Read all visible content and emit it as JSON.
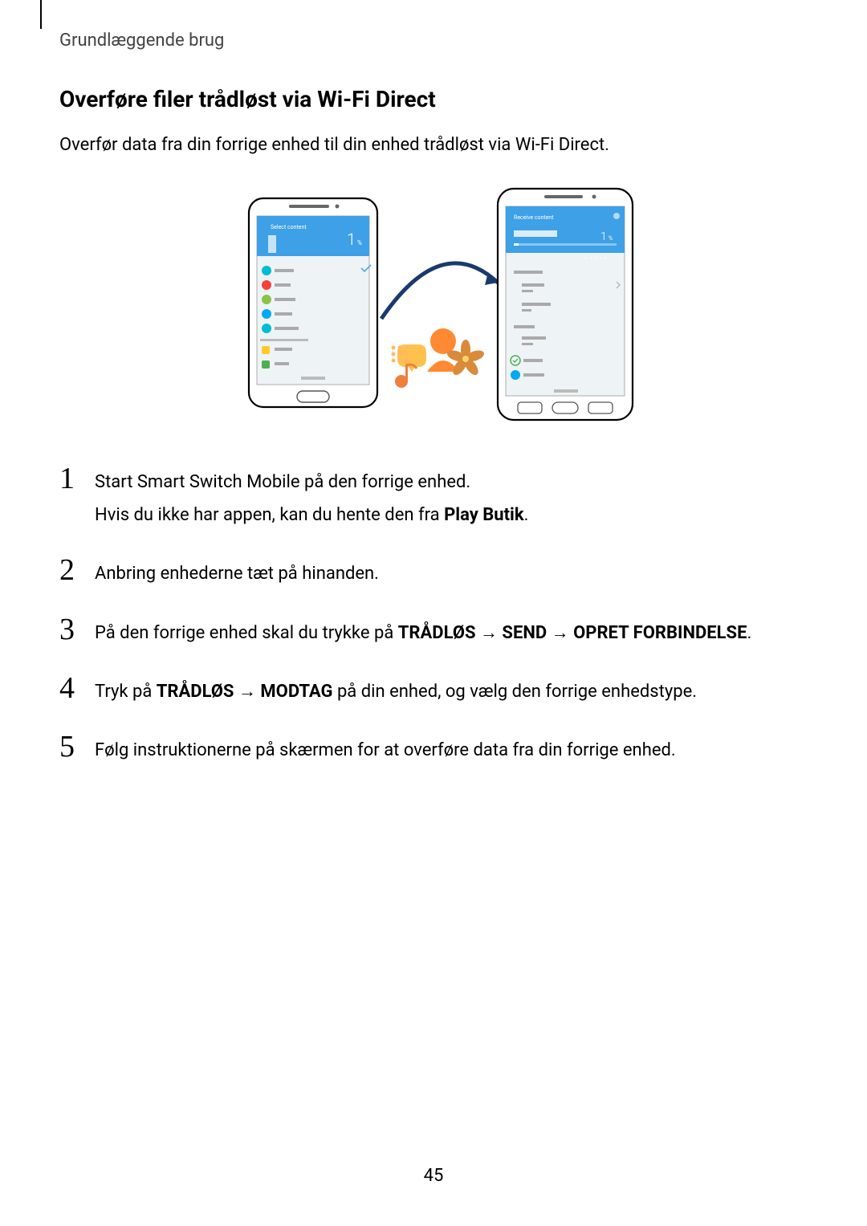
{
  "breadcrumb": "Grundlæggende brug",
  "heading": "Overføre filer trådløst via Wi-Fi Direct",
  "intro": "Overfør data fra din forrige enhed til din enhed trådløst via Wi-Fi Direct.",
  "steps": [
    {
      "num": "1",
      "line1_a": "Start Smart Switch Mobile på den forrige enhed.",
      "line2_a": "Hvis du ikke har appen, kan du hente den fra ",
      "line2_b": "Play Butik",
      "line2_c": "."
    },
    {
      "num": "2",
      "line1_a": "Anbring enhederne tæt på hinanden."
    },
    {
      "num": "3",
      "line1_a": "På den forrige enhed skal du trykke på ",
      "line1_b": "TRÅDLØS",
      "line1_c": " → ",
      "line1_d": "SEND",
      "line1_e": " → ",
      "line1_f": "OPRET FORBINDELSE",
      "line1_g": "."
    },
    {
      "num": "4",
      "line1_a": "Tryk på ",
      "line1_b": "TRÅDLØS",
      "line1_c": " → ",
      "line1_d": "MODTAG",
      "line1_e": " på din enhed, og vælg den forrige enhedstype."
    },
    {
      "num": "5",
      "line1_a": "Følg instruktionerne på skærmen for at overføre data fra din forrige enhed."
    }
  ],
  "page_number": "45"
}
